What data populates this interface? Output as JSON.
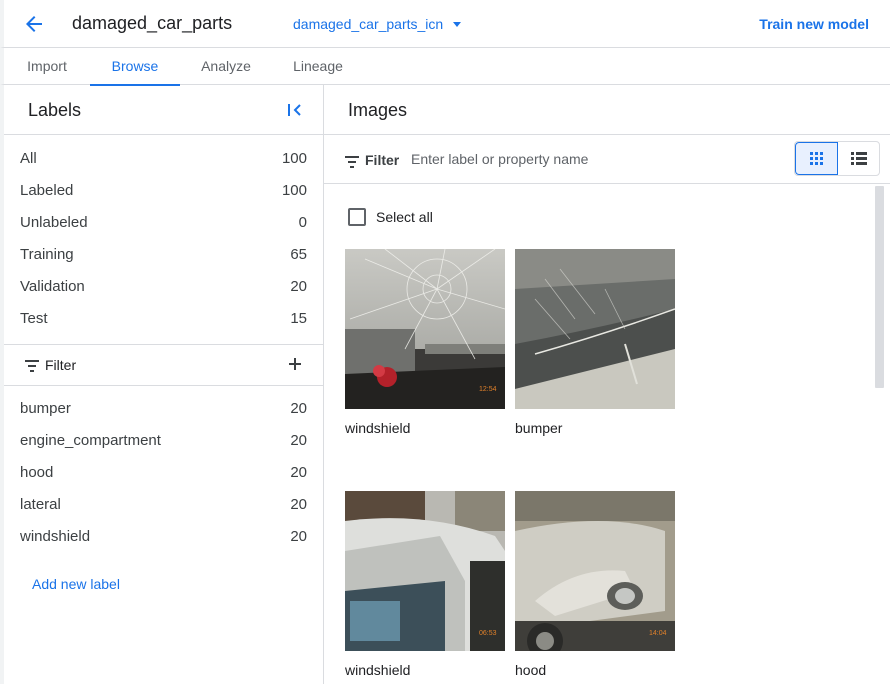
{
  "header": {
    "dataset_title": "damaged_car_parts",
    "dataset_selector": "damaged_car_parts_icn",
    "train_button": "Train new model"
  },
  "tabs": [
    {
      "label": "Import"
    },
    {
      "label": "Browse"
    },
    {
      "label": "Analyze"
    },
    {
      "label": "Lineage"
    }
  ],
  "sidebar": {
    "title": "Labels",
    "counts": [
      {
        "label": "All",
        "count": "100"
      },
      {
        "label": "Labeled",
        "count": "100"
      },
      {
        "label": "Unlabeled",
        "count": "0"
      },
      {
        "label": "Training",
        "count": "65"
      },
      {
        "label": "Validation",
        "count": "20"
      },
      {
        "label": "Test",
        "count": "15"
      }
    ],
    "filter_label": "Filter",
    "labels": [
      {
        "label": "bumper",
        "count": "20"
      },
      {
        "label": "engine_compartment",
        "count": "20"
      },
      {
        "label": "hood",
        "count": "20"
      },
      {
        "label": "lateral",
        "count": "20"
      },
      {
        "label": "windshield",
        "count": "20"
      }
    ],
    "add_label": "Add new label"
  },
  "main": {
    "title": "Images",
    "filter_label": "Filter",
    "filter_placeholder": "Enter label or property name",
    "select_all": "Select all",
    "images": [
      {
        "label": "windshield"
      },
      {
        "label": "bumper"
      },
      {
        "label": "windshield"
      },
      {
        "label": "hood"
      }
    ]
  },
  "colors": {
    "accent": "#1a73e8",
    "border": "#dadce0",
    "selected_bg": "#e8f0fe"
  }
}
